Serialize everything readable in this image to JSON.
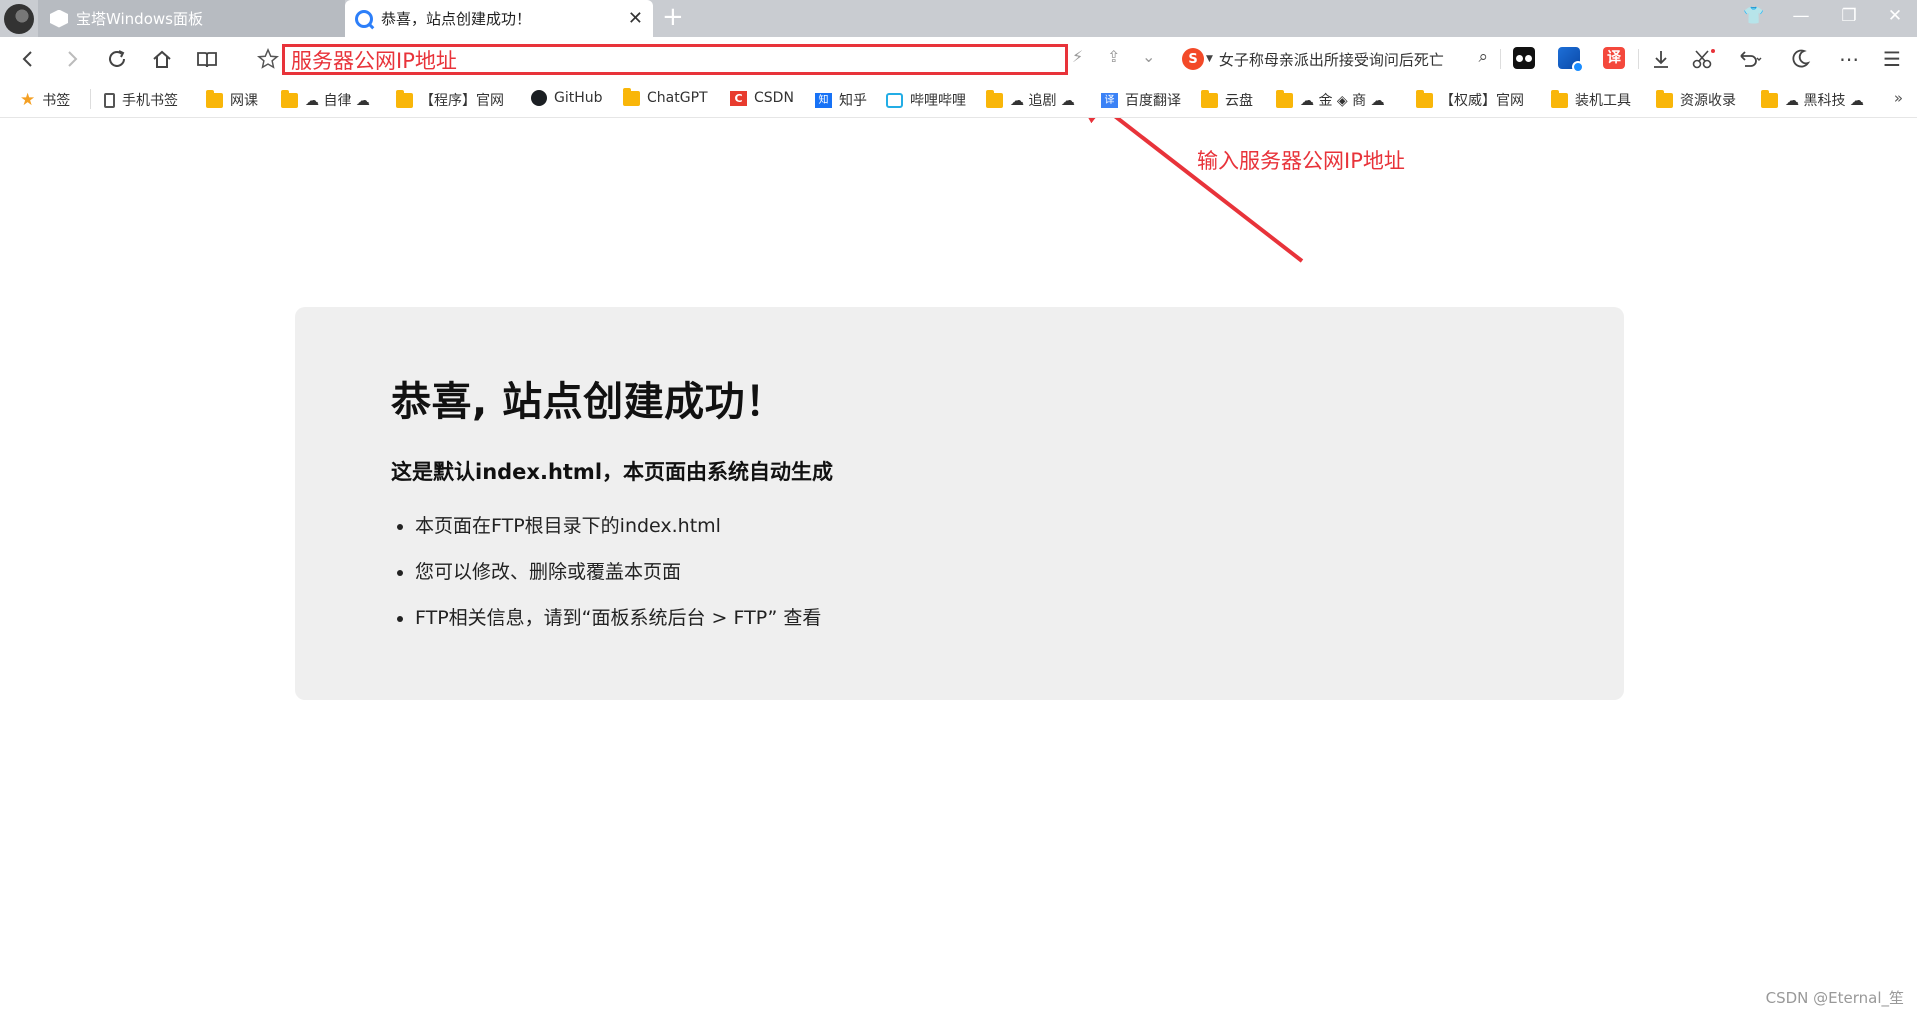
{
  "tabs": [
    {
      "title": "宝塔Windows面板",
      "active": false
    },
    {
      "title": "恭喜，站点创建成功！",
      "active": true
    }
  ],
  "toolbar": {
    "address_value": "服务器公网IP地址",
    "search_text": "女子称母亲派出所接受询问后死亡",
    "ext_red_label": "译"
  },
  "bookmarks": [
    {
      "label": "书签",
      "icon": "star-icon"
    },
    {
      "label": "手机书签",
      "icon": "phone-icon"
    },
    {
      "label": "网课",
      "icon": "folder-icon"
    },
    {
      "label": "☁ 自律 ☁",
      "icon": "folder-icon"
    },
    {
      "label": "【程序】官网",
      "icon": "folder-icon"
    },
    {
      "label": "GitHub",
      "icon": "github-icon"
    },
    {
      "label": "ChatGPT",
      "icon": "folder-icon"
    },
    {
      "label": "CSDN",
      "icon": "csdn-icon"
    },
    {
      "label": "知乎",
      "icon": "zhihu-icon"
    },
    {
      "label": "哔哩哔哩",
      "icon": "bilibili-icon"
    },
    {
      "label": "☁ 追剧 ☁",
      "icon": "folder-icon"
    },
    {
      "label": "百度翻译",
      "icon": "translate-icon"
    },
    {
      "label": "云盘",
      "icon": "folder-icon"
    },
    {
      "label": "☁ 金 ◈ 商 ☁",
      "icon": "folder-icon"
    },
    {
      "label": "【权威】官网",
      "icon": "folder-icon"
    },
    {
      "label": "装机工具",
      "icon": "folder-icon"
    },
    {
      "label": "资源收录",
      "icon": "folder-icon"
    },
    {
      "label": "☁ 黑科技 ☁",
      "icon": "folder-icon"
    }
  ],
  "annotation": {
    "text": "输入服务器公网IP地址",
    "color": "#e8333a"
  },
  "page": {
    "heading": "恭喜, 站点创建成功！",
    "subheading": "这是默认index.html，本页面由系统自动生成",
    "items": [
      "本页面在FTP根目录下的index.html",
      "您可以修改、删除或覆盖本页面",
      "FTP相关信息，请到“面板系统后台 > FTP” 查看"
    ]
  },
  "watermark": "CSDN @Eternal_笙",
  "colors": {
    "accent_red": "#e8333a",
    "tabstrip": "#c9ccd1",
    "card_bg": "#efefef"
  }
}
